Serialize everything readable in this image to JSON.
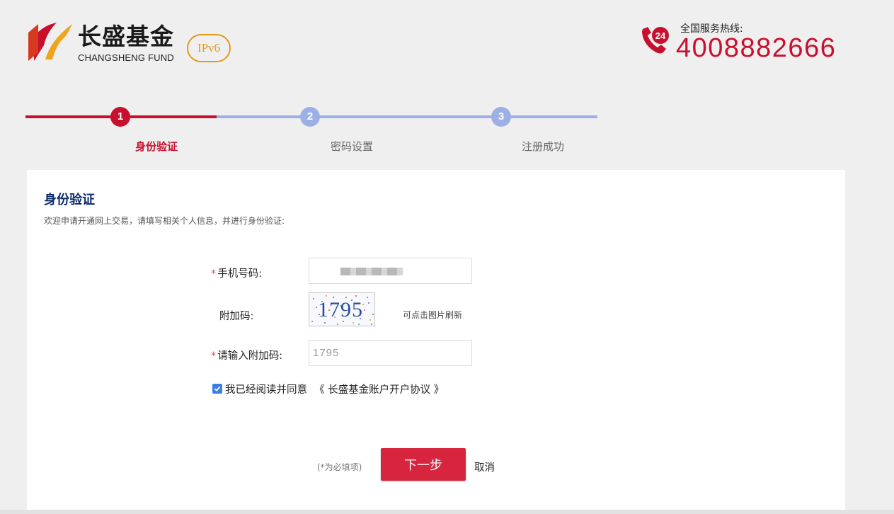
{
  "brand": {
    "name_cn": "长盛基金",
    "name_en": "CHANGSHENG FUND",
    "badge": "IPv6",
    "accent_color": "#c8102e"
  },
  "hotline": {
    "label": "全国服务热线:",
    "number": "4008882666",
    "icon_text": "24"
  },
  "steps": [
    {
      "num": "1",
      "label": "身份验证",
      "state": "active"
    },
    {
      "num": "2",
      "label": "密码设置",
      "state": "inactive"
    },
    {
      "num": "3",
      "label": "注册成功",
      "state": "inactive"
    }
  ],
  "form": {
    "title": "身份验证",
    "description": "欢迎申请开通网上交易，请填写相关个人信息，并进行身份验证:",
    "phone": {
      "required_mark": "*",
      "label": "手机号码:",
      "value": ""
    },
    "captcha": {
      "label": "附加码:",
      "image_text": "1795",
      "hint": "可点击图片刷新"
    },
    "captcha_input": {
      "required_mark": "*",
      "label": "请输入附加码:",
      "value": "1795"
    },
    "agreement": {
      "checked": true,
      "text": "我已经阅读并同意",
      "link": "《 长盛基金账户开户协议 》"
    },
    "required_note": "(*为必填项)",
    "next_label": "下一步",
    "cancel_label": "取消"
  }
}
